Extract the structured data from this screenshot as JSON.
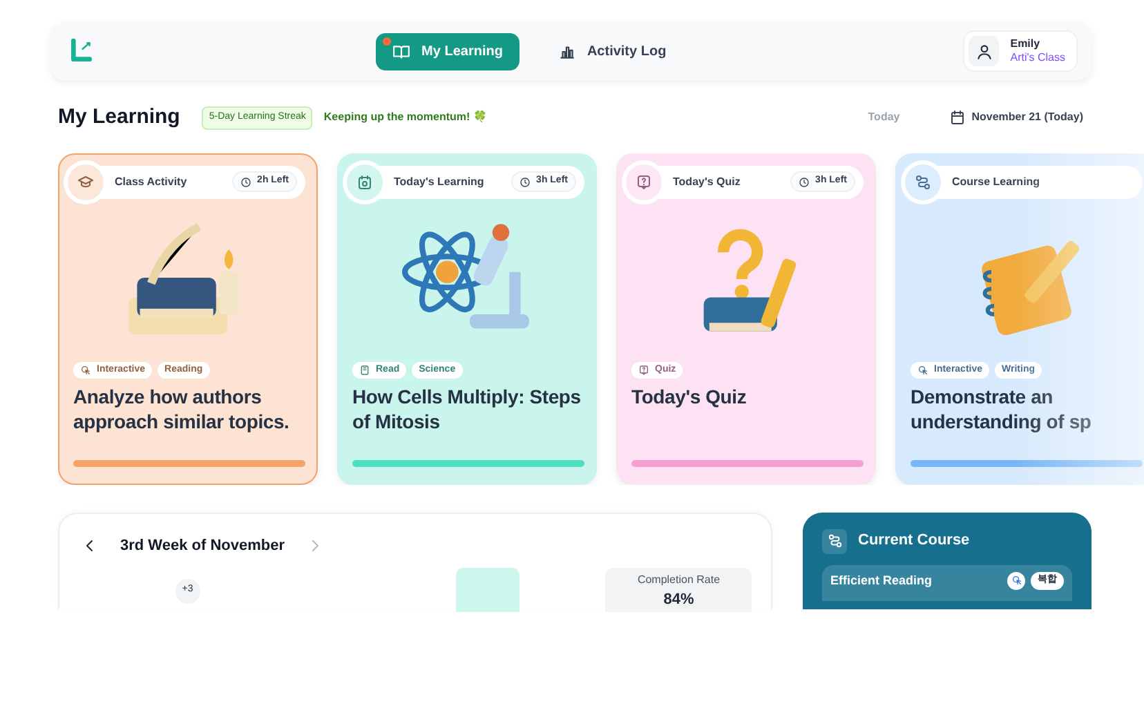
{
  "header": {
    "nav": [
      {
        "label": "My Learning",
        "kind": "book",
        "selected": true,
        "notification": true
      },
      {
        "label": "Activity Log",
        "kind": "chart",
        "selected": false,
        "notification": false
      }
    ],
    "user": {
      "name": "Emily",
      "class": "Arti's Class"
    }
  },
  "title": "My Learning",
  "streak": "5-Day Learning Streak",
  "streak_message": "Keeping up the momentum! 🍀",
  "date_nav": [
    {
      "label": "Today",
      "disabled": true,
      "kind": "plain"
    },
    {
      "label": "November 21 (Today)",
      "disabled": false,
      "kind": "calendar"
    }
  ],
  "cards": [
    {
      "category": "Class Activity",
      "kind": "activity",
      "time_left": "2h Left",
      "selected": true,
      "color": "#f4a36c",
      "tags": [
        {
          "label": "Interactive",
          "kind": "interactive"
        },
        {
          "label": "Reading",
          "kind": "plain"
        }
      ],
      "title": "Analyze how authors approach similar topics."
    },
    {
      "category": "Today's Learning",
      "kind": "learning",
      "time_left": "3h Left",
      "selected": false,
      "color": "#4fdfbf",
      "tags": [
        {
          "label": "Read",
          "kind": "read"
        },
        {
          "label": "Science",
          "kind": "plain"
        }
      ],
      "title": "How Cells Multiply: Steps of Mitosis"
    },
    {
      "category": "Today's Quiz",
      "kind": "quiz",
      "time_left": "3h Left",
      "selected": false,
      "color": "#f59fd2",
      "tags": [
        {
          "label": "Quiz",
          "kind": "quiz"
        }
      ],
      "title": "Today's Quiz"
    },
    {
      "category": "Course Learning",
      "kind": "course",
      "selected": false,
      "color": "#78b6f5",
      "tags": [
        {
          "label": "Interactive",
          "kind": "interactive"
        },
        {
          "label": "Writing",
          "kind": "plain"
        }
      ],
      "title": "Demonstrate an understanding of sp"
    }
  ],
  "week": {
    "label": "3rd Week of November",
    "more": "+3",
    "completion_label": "Completion Rate",
    "completion_value": "84%"
  },
  "current_course": {
    "title": "Current Course",
    "course": "Efficient Reading",
    "badge": "복합"
  }
}
